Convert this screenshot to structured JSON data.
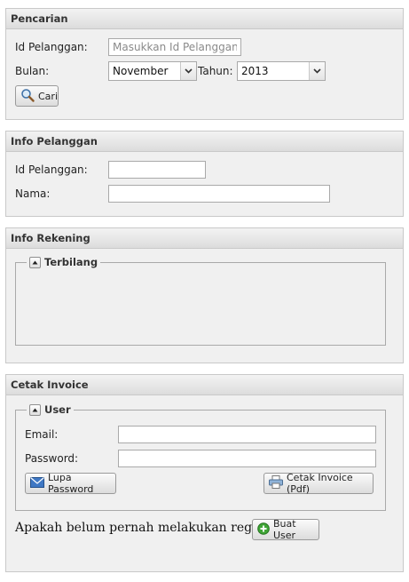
{
  "search": {
    "title": "Pencarian",
    "id_label": "Id Pelanggan:",
    "id_placeholder": "Masukkan Id Pelanggan",
    "month_label": "Bulan:",
    "month_value": "November",
    "year_label": "Tahun:",
    "year_value": "2013",
    "search_button": "Cari"
  },
  "customer_info": {
    "title": "Info Pelanggan",
    "id_label": "Id Pelanggan:",
    "name_label": "Nama:"
  },
  "account_info": {
    "title": "Info Rekening",
    "group_title": "Terbilang"
  },
  "invoice": {
    "title": "Cetak Invoice",
    "group_title": "User",
    "email_label": "Email:",
    "password_label": "Password:",
    "forgot_button": "Lupa Password",
    "print_button": "Cetak Invoice (Pdf)",
    "register_text": "Apakah belum pernah melakukan registrasi?",
    "create_user_button": "Buat User"
  }
}
